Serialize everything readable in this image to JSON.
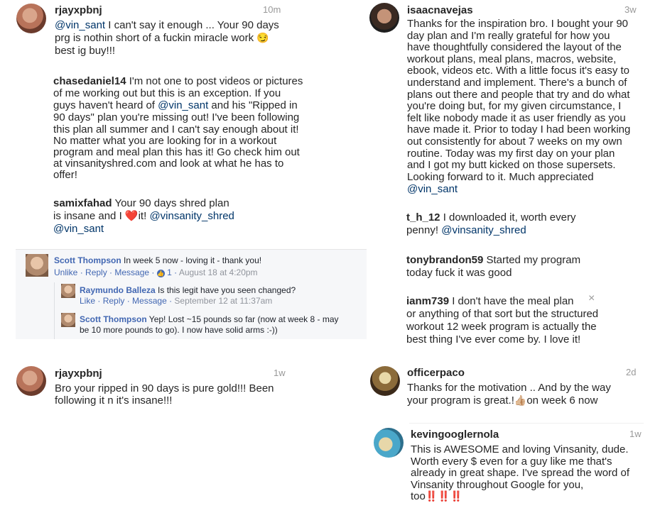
{
  "left_col": {
    "c1": {
      "user": "rjayxpbnj",
      "time": "10m",
      "mention": "@vin_sant",
      "text1": " I can't say it enough ... Your 90 days",
      "line2": "prg is nothin short of a fuckin miracle work",
      "emoji": "😏",
      "line3": "best ig buy!!!"
    },
    "c2": {
      "user": "chasedaniel14",
      "l1": " I'm not one to post videos or pictures",
      "l2": "of me working out but this is an exception. If you",
      "l3a": "guys haven't heard of ",
      "l3m": "@vin_sant",
      "l3b": " and his \"Ripped in",
      "l4": "90 days\" plan you're missing out! I've been following",
      "l5": "this plan all summer and I can't say enough about it!",
      "l6": "No matter what you are looking for in a workout",
      "l7": "program and meal plan this has it! Go check him out",
      "l8": "at vinsanityshred.com and look at what he has to",
      "l9": "offer!"
    },
    "c3": {
      "user": "samixfahad",
      "l1": " Your 90 days shred plan",
      "l2a": "is insane and I ",
      "heart": "❤️",
      "l2b": "it! ",
      "m1": "@vinsanity_shred",
      "m2": "@vin_sant"
    },
    "fb": {
      "c1": {
        "name": "Scott Thompson",
        "msg": " In week 5 now - loving it - thank you!",
        "unlike": "Unlike",
        "reply": "Reply",
        "message": "Message",
        "likes": "1",
        "date": "August 18 at 4:20pm"
      },
      "c2": {
        "name": "Raymundo Balleza",
        "msg": " Is this legit have you seen changed?",
        "like": "Like",
        "reply": "Reply",
        "message": "Message",
        "date": "September 12 at 11:37am"
      },
      "c3": {
        "name": "Scott Thompson",
        "msg": " Yep! Lost ~15 pounds so far (now at week 8 - may",
        "msg2": "be 10 more pounds to go). I now have solid arms :-))"
      }
    },
    "c4": {
      "user": "rjayxpbnj",
      "time": "1w",
      "l1": "Bro your ripped in 90 days is pure gold!!! Been",
      "l2": "following it n it's insane!!!"
    }
  },
  "right_col": {
    "c1": {
      "user": "isaacnavejas",
      "time": "3w",
      "lines": [
        "Thanks for the inspiration bro. I bought your 90",
        "day plan and I'm really grateful for how you",
        "have thoughtfully considered the layout of the",
        "workout plans, meal plans, macros, website,",
        "ebook, videos etc. With a little focus it's easy to",
        "understand and implement. There's a bunch of",
        "plans out there and people that try and do what",
        "you're doing but, for my given circumstance, I",
        "felt like nobody made it as user friendly as you",
        "have made it. Prior to today I had been working",
        "out consistently for about 7 weeks on my own",
        "routine. Today was my first day on your plan",
        "and I got my butt kicked on those supersets.",
        "Looking forward to it.  Much appreciated"
      ],
      "mention": "@vin_sant"
    },
    "c2": {
      "user": "t_h_12",
      "l1": " I downloaded it, worth every",
      "l2": "penny! ",
      "mention": "@vinsanity_shred"
    },
    "c3": {
      "user": "tonybrandon59",
      "l1": " Started my program",
      "l2": "today fuck it was good"
    },
    "c4": {
      "user": "ianm739",
      "l1": " I don't have the meal plan",
      "l2": "or anything of that sort but the structured",
      "l3": "workout 12 week program is actually the",
      "l4": "best thing I've ever come by. I love it!"
    },
    "c5": {
      "user": "officerpaco",
      "time": "2d",
      "l1": "Thanks for the motivation .. And by the way",
      "l2a": "your program is great.!",
      "thumb": "👍🏼",
      "l2b": "on week 6 now"
    },
    "c6": {
      "user": "kevingooglernola",
      "time": "1w",
      "l1": "This is AWESOME and loving Vinsanity, dude.",
      "l2": "Worth every $ even for a guy like me that's",
      "l3": "already in great shape. I've spread the word of",
      "l4": "Vinsanity throughout Google for you,",
      "l5": "too",
      "bangs": "‼️‼️‼️"
    }
  },
  "icons": {
    "close": "×",
    "like_badge": "👍"
  }
}
